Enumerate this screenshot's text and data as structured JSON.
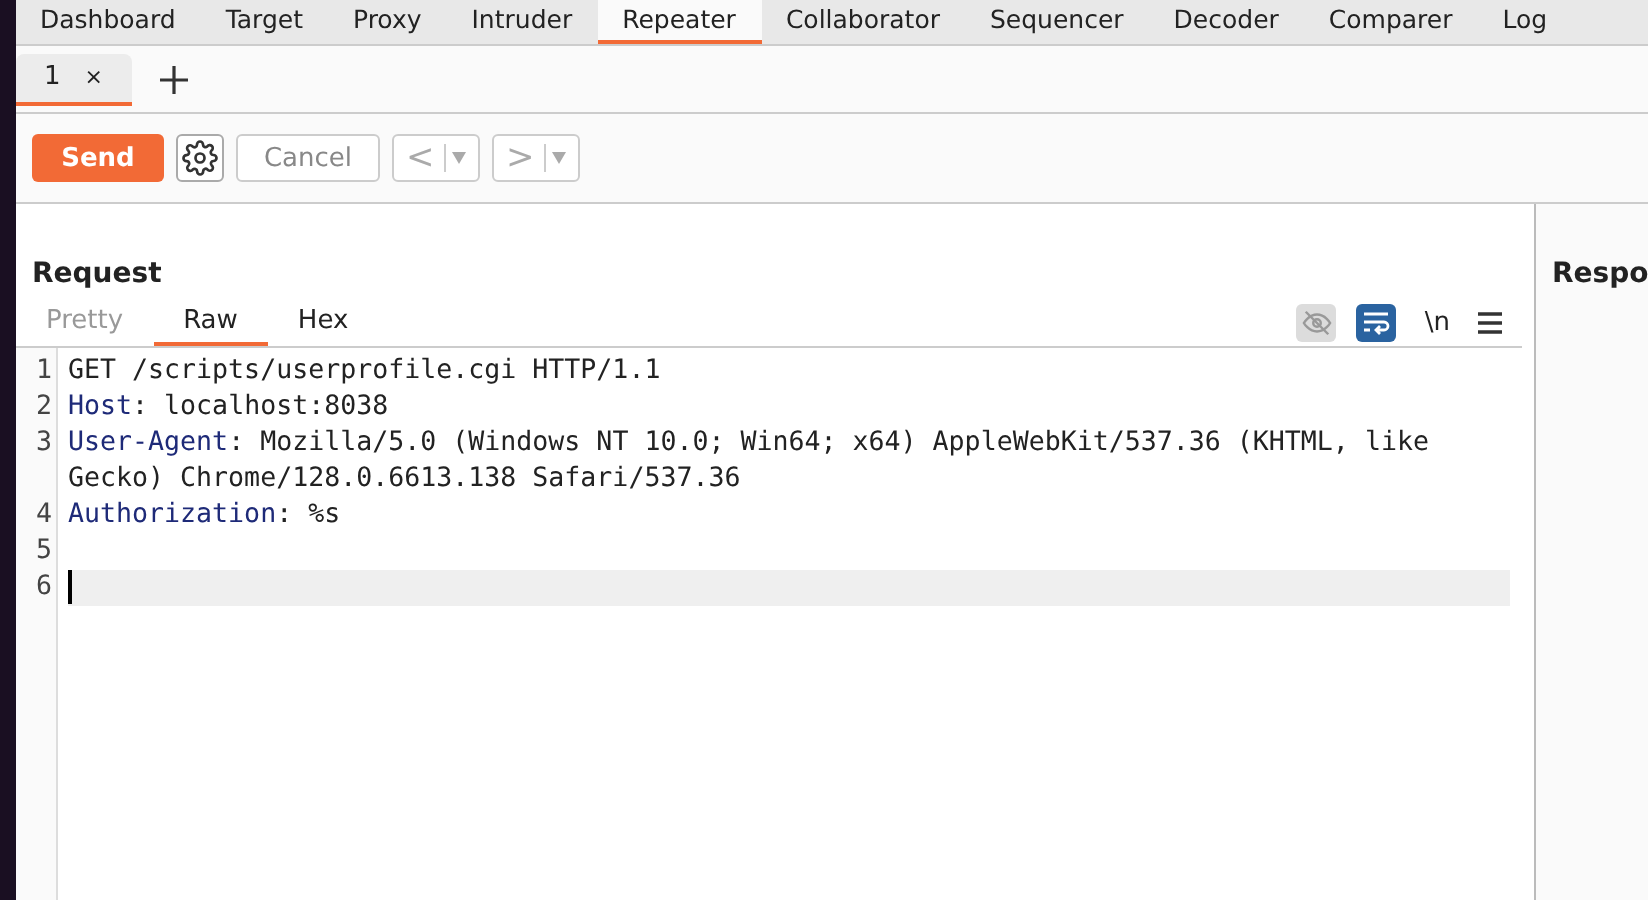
{
  "main_tabs": [
    {
      "label": "Dashboard",
      "selected": false
    },
    {
      "label": "Target",
      "selected": false
    },
    {
      "label": "Proxy",
      "selected": false
    },
    {
      "label": "Intruder",
      "selected": false
    },
    {
      "label": "Repeater",
      "selected": true
    },
    {
      "label": "Collaborator",
      "selected": false
    },
    {
      "label": "Sequencer",
      "selected": false
    },
    {
      "label": "Decoder",
      "selected": false
    },
    {
      "label": "Comparer",
      "selected": false
    },
    {
      "label": "Log",
      "selected": false
    }
  ],
  "repeater_tabs": [
    {
      "label": "1",
      "close": "×",
      "selected": true
    }
  ],
  "toolbar": {
    "send": "Send",
    "cancel": "Cancel",
    "cancel_disabled": true,
    "back": "<",
    "forward": ">",
    "nav_disabled": true
  },
  "request": {
    "title": "Request",
    "view_tabs": [
      {
        "label": "Pretty",
        "selected": false,
        "disabled": true
      },
      {
        "label": "Raw",
        "selected": true,
        "disabled": false
      },
      {
        "label": "Hex",
        "selected": false,
        "disabled": false
      }
    ],
    "hide_nonprintable": false,
    "wrap_lines": true,
    "newline_label": "\\n",
    "lines": [
      {
        "number": "1",
        "text": "GET /scripts/userprofile.cgi HTTP/1.1",
        "current": false
      },
      {
        "number": "2",
        "header_name": "Host",
        "text": ": localhost:8038",
        "current": false
      },
      {
        "number": "3",
        "header_name": "User-Agent",
        "text": ": Mozilla/5.0 (Windows NT 10.0; Win64; x64) AppleWebKit/537.36 (KHTML, like Gecko) Chrome/128.0.6613.138 Safari/537.36",
        "current": false
      },
      {
        "number": "4",
        "header_name": "Authorization",
        "text": ": %s",
        "current": false
      },
      {
        "number": "5",
        "current": false
      },
      {
        "number": "6",
        "current": true
      }
    ]
  },
  "response": {
    "title": "Respo"
  }
}
